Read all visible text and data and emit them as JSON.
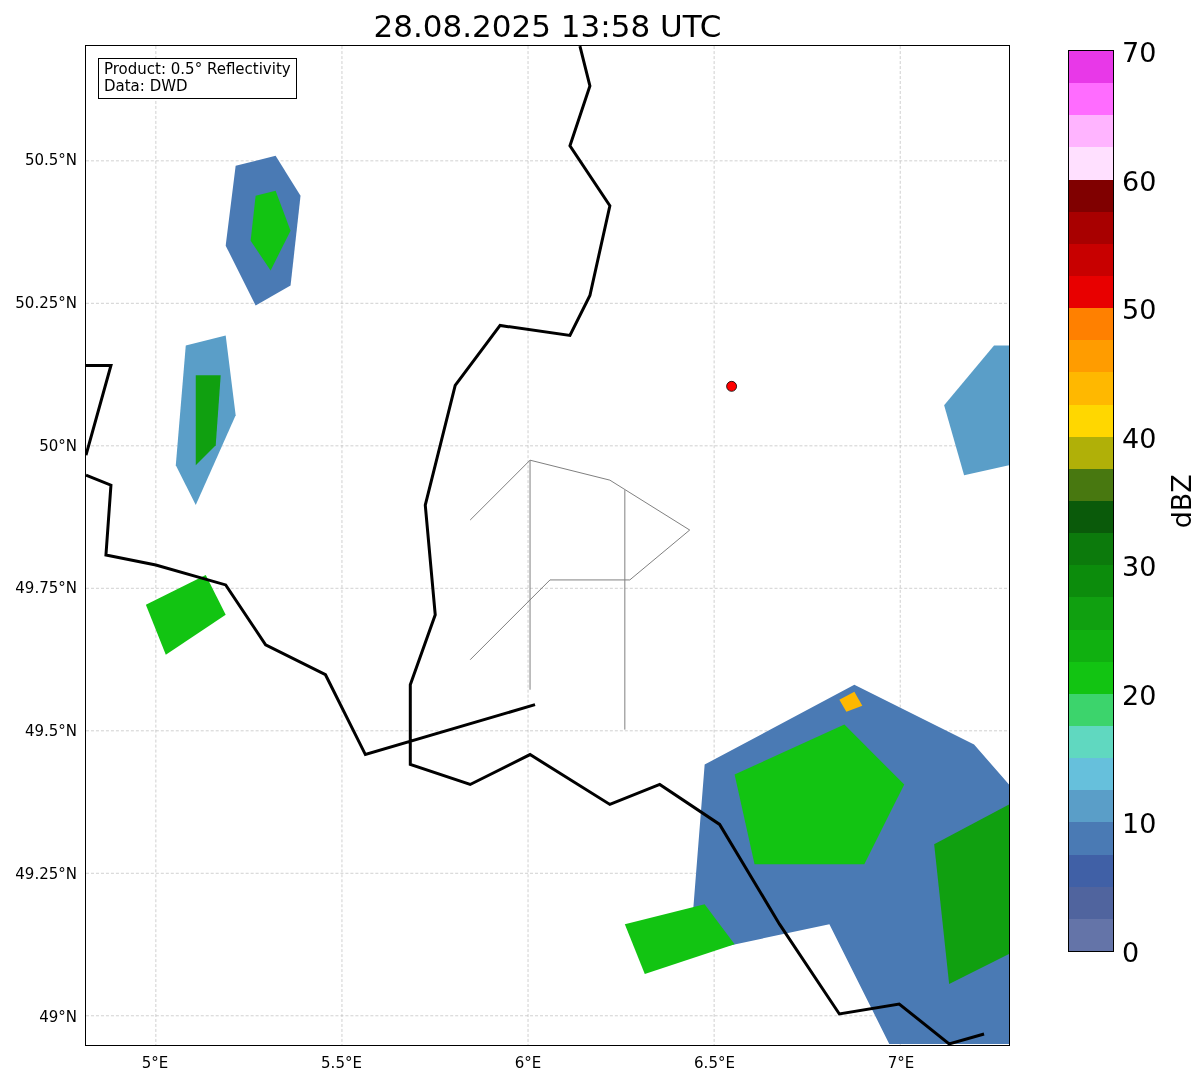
{
  "title": "28.08.2025 13:58 UTC",
  "info_box": [
    "Product: 0.5° Reflectivity",
    "Data: DWD"
  ],
  "y_ticks": [
    "50.5°N",
    "50.25°N",
    "50°N",
    "49.75°N",
    "49.5°N",
    "49.25°N",
    "49°N"
  ],
  "x_ticks": [
    "5°E",
    "5.5°E",
    "6°E",
    "6.5°E",
    "7°E"
  ],
  "colorbar": {
    "label": "dBZ",
    "ticks": [
      "70",
      "60",
      "50",
      "40",
      "30",
      "20",
      "10",
      "0"
    ],
    "segments": [
      {
        "color": "#6474a8"
      },
      {
        "color": "#50649e"
      },
      {
        "color": "#4060a6"
      },
      {
        "color": "#4a7ab4"
      },
      {
        "color": "#5a9ec8"
      },
      {
        "color": "#66c0dc"
      },
      {
        "color": "#60d8c0"
      },
      {
        "color": "#3cd46c"
      },
      {
        "color": "#12c412"
      },
      {
        "color": "#10b010"
      },
      {
        "color": "#10a010"
      },
      {
        "color": "#0c8c0c"
      },
      {
        "color": "#0c7a0c"
      },
      {
        "color": "#0a5a0a"
      },
      {
        "color": "#487810"
      },
      {
        "color": "#b0b008"
      },
      {
        "color": "#ffd700"
      },
      {
        "color": "#ffb800"
      },
      {
        "color": "#ff9c00"
      },
      {
        "color": "#ff8000"
      },
      {
        "color": "#e80000"
      },
      {
        "color": "#c80000"
      },
      {
        "color": "#a80000"
      },
      {
        "color": "#800000"
      },
      {
        "color": "#ffe0ff"
      },
      {
        "color": "#ffb4ff"
      },
      {
        "color": "#ff6cff"
      },
      {
        "color": "#e838e8"
      }
    ]
  }
}
